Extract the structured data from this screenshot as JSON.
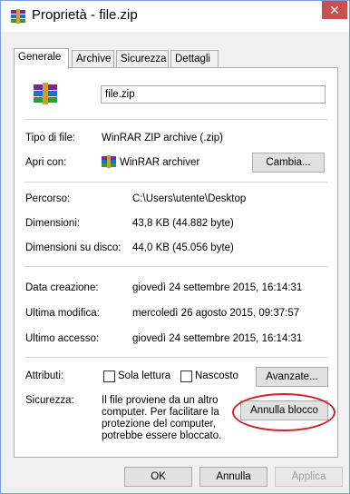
{
  "window": {
    "title": "Proprietà - file.zip",
    "close_glyph": "✕"
  },
  "tabs": [
    {
      "label": "Generale"
    },
    {
      "label": "Archive"
    },
    {
      "label": "Sicurezza"
    },
    {
      "label": "Dettagli"
    }
  ],
  "general": {
    "filename": "file.zip",
    "type_label": "Tipo di file:",
    "type_value": "WinRAR ZIP archive (.zip)",
    "opens_label": "Apri con:",
    "opens_value": "WinRAR archiver",
    "change_button": "Cambia...",
    "path_label": "Percorso:",
    "path_value": "C:\\Users\\utente\\Desktop",
    "size_label": "Dimensioni:",
    "size_value": "43,8 KB (44.882 byte)",
    "disk_label": "Dimensioni su disco:",
    "disk_value": "44,0 KB (45.056 byte)",
    "created_label": "Data creazione:",
    "created_value": "giovedì 24 settembre 2015, 16:14:31",
    "modified_label": "Ultima modifica:",
    "modified_value": "mercoledì 26 agosto 2015, 09:37:57",
    "accessed_label": "Ultimo accesso:",
    "accessed_value": "giovedì 24 settembre 2015, 16:14:31",
    "attributes_label": "Attributi:",
    "readonly_label": "Sola lettura",
    "hidden_label": "Nascosto",
    "advanced_button": "Avanzate...",
    "security_label": "Sicurezza:",
    "security_text": "Il file proviene da un altro computer. Per facilitare la protezione del computer, potrebbe essere bloccato.",
    "unblock_button": "Annulla blocco"
  },
  "footer": {
    "ok": "OK",
    "cancel": "Annulla",
    "apply": "Applica"
  },
  "icons": {
    "title": "winrar-icon",
    "file": "winrar-file-icon",
    "app": "winrar-app-icon"
  },
  "colors": {
    "highlight_ellipse": "#d0232a",
    "close_button": "#c75050"
  }
}
